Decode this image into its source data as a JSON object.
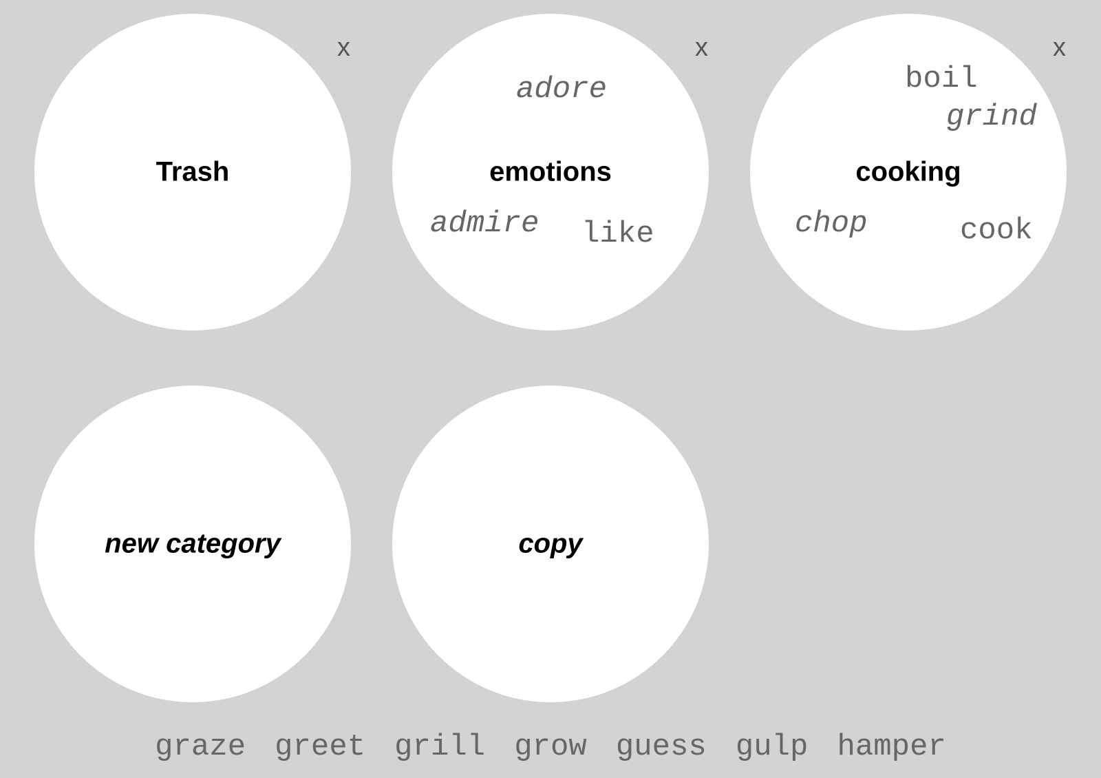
{
  "circles": {
    "trash": {
      "label": "Trash",
      "close": "x"
    },
    "emotions": {
      "label": "emotions",
      "close": "x",
      "words": {
        "adore": "adore",
        "admire": "admire",
        "like": "like"
      }
    },
    "cooking": {
      "label": "cooking",
      "close": "x",
      "words": {
        "boil": "boil",
        "grind": "grind",
        "chop": "chop",
        "cook": "cook"
      }
    },
    "new_category": {
      "label": "new category"
    },
    "copy": {
      "label": "copy"
    }
  },
  "pool": {
    "graze": "graze",
    "greet": "greet",
    "grill": "grill",
    "grow": "grow",
    "guess": "guess",
    "gulp": "gulp",
    "hamper": "hamper"
  }
}
